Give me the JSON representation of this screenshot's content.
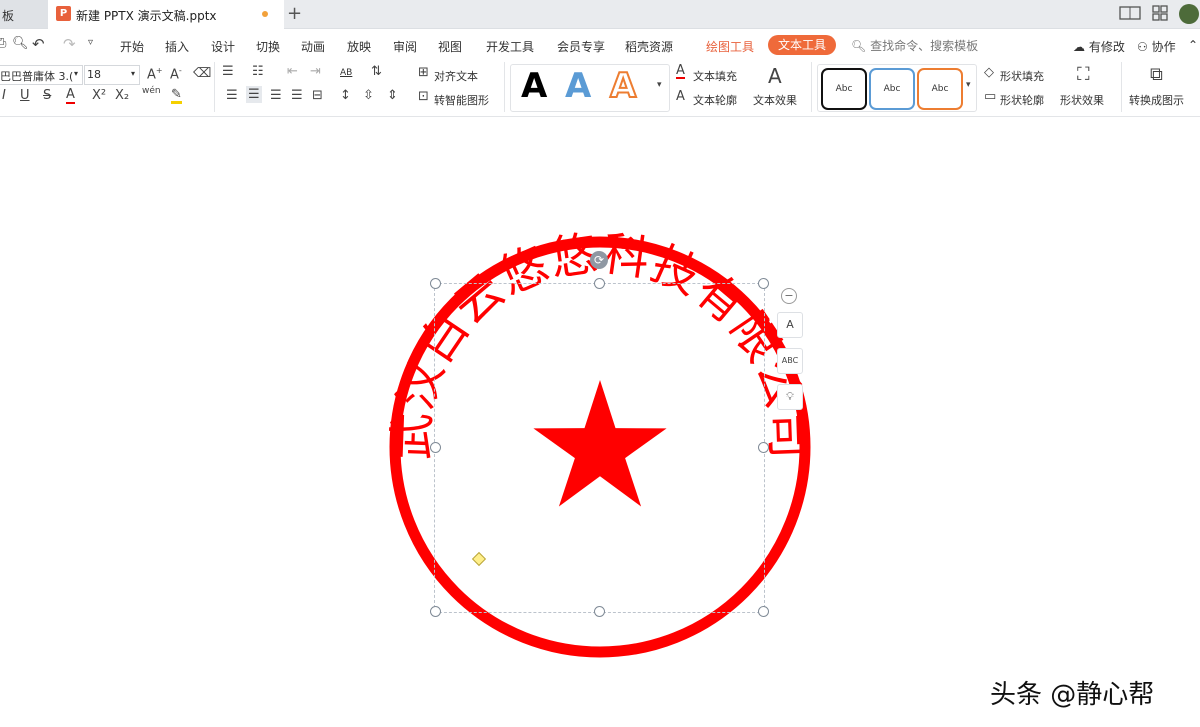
{
  "tabs": {
    "prev_label": "板",
    "active_label": "新建 PPTX 演示文稿.pptx",
    "ppt_icon_letter": "P",
    "plus_label": "+"
  },
  "menu": {
    "items": [
      "开始",
      "插入",
      "设计",
      "切换",
      "动画",
      "放映",
      "审阅",
      "视图",
      "开发工具",
      "会员专享",
      "稻壳资源"
    ],
    "drawing_tools": "绘图工具",
    "text_tools": "文本工具",
    "search_placeholder": "查找命令、搜索模板",
    "has_changes": "有修改",
    "collaborate": "协作"
  },
  "ribbon": {
    "font_name": "巴巴普庸体 3.(",
    "font_size": "18",
    "align_text": "对齐文本",
    "smart_shape": "转智能图形",
    "text_fill": "文本填充",
    "text_outline": "文本轮廓",
    "text_effects": "文本效果",
    "shape_fill": "形状填充",
    "shape_outline": "形状轮廓",
    "shape_effects": "形状效果",
    "convert_to_shape": "转换成图示",
    "art_sample": "A",
    "shape_sample": "Abc",
    "ab_label": "AB",
    "pinyin_label": "wén"
  },
  "stamp": {
    "company_text": "武汉白云悠悠科技有限公司",
    "color": "#ff0000"
  },
  "colors": {
    "accent_orange": "#e8613c",
    "stamp_red": "#ff0000"
  },
  "watermark": "头条 @静心帮"
}
